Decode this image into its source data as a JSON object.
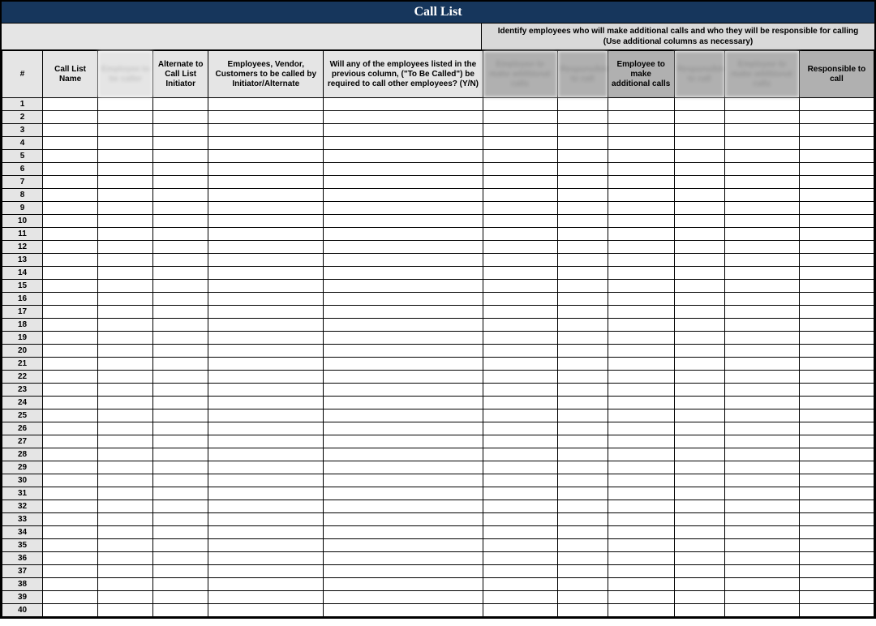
{
  "title": "Call List",
  "sub_header_right": "Identify employees who will make additional calls and who they will be responsible for calling (Use additional columns as necessary)",
  "columns": {
    "num": "#",
    "name": "Call List Name",
    "blur1": "Employee to be caller",
    "alt": "Alternate to Call List Initiator",
    "emp": "Employees, Vendor, Customers to be called by Initiator/Alternate",
    "will": "Will any of the employees listed in the previous column, (\"To Be Called\") be required to call other employees? (Y/N)",
    "b2": "Employee to make additional calls",
    "b3": "Responsible to call",
    "empmake": "Employee to make additional calls",
    "b4": "Responsible to call",
    "b5": "Employee to make additional calls",
    "resp": "Responsible to call"
  },
  "row_count": 40
}
